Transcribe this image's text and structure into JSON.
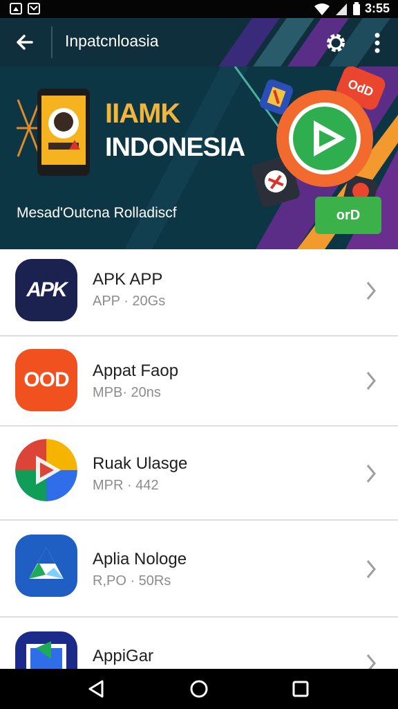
{
  "status_bar": {
    "time": "3:55"
  },
  "toolbar": {
    "title": "Inpatcnloasia"
  },
  "banner": {
    "title_line1": "IIAMK",
    "title_line2": "INDONESIA",
    "subtitle": "Mesad'Outcna Rolladiscf",
    "badge_text": "OdD",
    "button_label": "orD"
  },
  "apps": [
    {
      "icon_text": "APK",
      "name": "APK APP",
      "meta": "APP  ·  20Gs"
    },
    {
      "icon_text": "OOD",
      "name": "Appat Faop",
      "meta": "MPB·  20ns"
    },
    {
      "icon_text": "",
      "name": "Ruak Ulasge",
      "meta": "MPR  ·  442"
    },
    {
      "icon_text": "",
      "name": "Aplia Nologe",
      "meta": "R,PO  ·  50Rs"
    },
    {
      "icon_text": "",
      "name": "AppiGar",
      "meta": ""
    }
  ],
  "colors": {
    "toolbar_bg": "#0f2f3d",
    "banner_bg": "#0d3645",
    "accent_orange": "#f26a2e",
    "accent_green": "#3cb14a",
    "apk_navy": "#1c2250"
  }
}
